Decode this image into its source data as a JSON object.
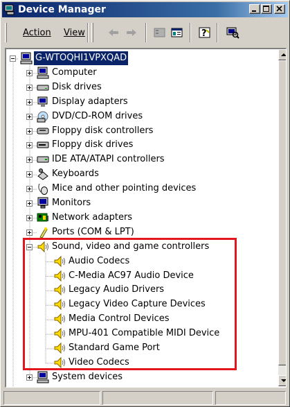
{
  "window": {
    "title": "Device Manager",
    "title_icon": "device-manager-icon",
    "caption_buttons": [
      "minimize",
      "maximize",
      "close"
    ]
  },
  "toolbar": {
    "menu": [
      {
        "label": "Action",
        "mnemonic": "A"
      },
      {
        "label": "View",
        "mnemonic": "V"
      }
    ],
    "buttons": [
      "back-arrow-icon",
      "forward-arrow-icon",
      "tree-view-icon",
      "properties-icon",
      "help-icon",
      "scan-hardware-icon"
    ]
  },
  "tree": {
    "root": {
      "label": "G-WTOQHI1VPXQAD",
      "icon": "computer-icon",
      "selected": true
    },
    "categories": [
      {
        "label": "Computer",
        "icon": "computer-icon",
        "expanded": false
      },
      {
        "label": "Disk drives",
        "icon": "disk-drive-icon",
        "expanded": false
      },
      {
        "label": "Display adapters",
        "icon": "display-adapter-icon",
        "expanded": false
      },
      {
        "label": "DVD/CD-ROM drives",
        "icon": "cdrom-icon",
        "expanded": false
      },
      {
        "label": "Floppy disk controllers",
        "icon": "floppy-controller-icon",
        "expanded": false
      },
      {
        "label": "Floppy disk drives",
        "icon": "floppy-drive-icon",
        "expanded": false
      },
      {
        "label": "IDE ATA/ATAPI controllers",
        "icon": "ide-controller-icon",
        "expanded": false
      },
      {
        "label": "Keyboards",
        "icon": "keyboard-icon",
        "expanded": false
      },
      {
        "label": "Mice and other pointing devices",
        "icon": "mouse-icon",
        "expanded": false
      },
      {
        "label": "Monitors",
        "icon": "monitor-icon",
        "expanded": false
      },
      {
        "label": "Network adapters",
        "icon": "network-adapter-icon",
        "expanded": false
      },
      {
        "label": "Ports (COM & LPT)",
        "icon": "port-icon",
        "expanded": false
      },
      {
        "label": "Sound, video and game controllers",
        "icon": "speaker-icon",
        "expanded": true,
        "children": [
          "Audio Codecs",
          "C-Media AC97 Audio Device",
          "Legacy Audio Drivers",
          "Legacy Video Capture Devices",
          "Media Control Devices",
          "MPU-401 Compatible MIDI Device",
          "Standard Game Port",
          "Video Codecs"
        ]
      },
      {
        "label": "System devices",
        "icon": "system-devices-icon",
        "expanded": false
      }
    ]
  },
  "annotation": {
    "color": "#e3161d",
    "target": "Sound, video and game controllers"
  },
  "colors": {
    "selection": "#0a246a",
    "titlebar_start": "#0a246a",
    "titlebar_end": "#a6caf0",
    "face": "#d4d0c8"
  }
}
